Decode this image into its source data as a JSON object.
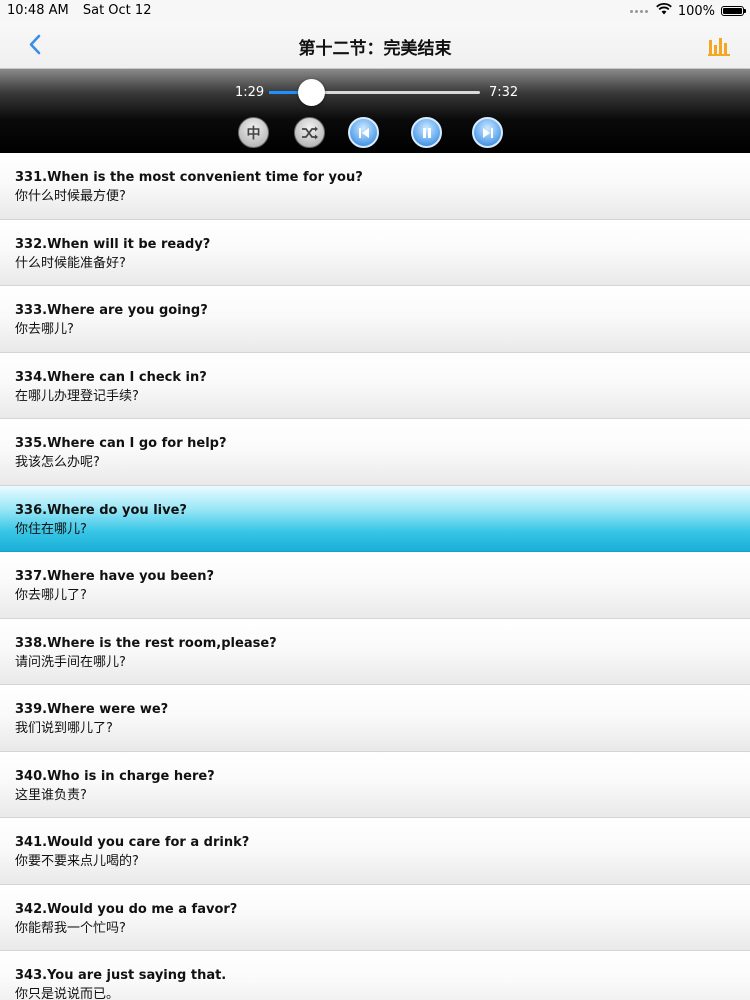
{
  "status_bar": {
    "time": "10:48 AM",
    "date": "Sat Oct 12",
    "battery": "100%",
    "icons": [
      "signal-dots-icon",
      "wifi-icon",
      "battery-icon"
    ]
  },
  "nav": {
    "title": "第十二节：完美结束",
    "back_icon": "chevron-left-icon",
    "chart_icon": "bar-chart-icon",
    "accent_color": "#3a8ee6",
    "chart_color": "#f5a623"
  },
  "player": {
    "current_time": "1:29",
    "total_time": "7:32",
    "progress": 0.198,
    "lang_label": "中",
    "buttons": [
      "lang-button",
      "shuffle-button",
      "previous-button",
      "pause-button",
      "next-button"
    ]
  },
  "list": {
    "active_index": 5,
    "items": [
      {
        "en": "331.When is the most convenient time for you?",
        "zh": "你什么时候最方便?"
      },
      {
        "en": "332.When will it be ready?",
        "zh": "什么时候能准备好?"
      },
      {
        "en": "333.Where are you going?",
        "zh": "你去哪儿?"
      },
      {
        "en": "334.Where can I check in?",
        "zh": "在哪儿办理登记手续?"
      },
      {
        "en": "335.Where can I go for help?",
        "zh": "我该怎么办呢?"
      },
      {
        "en": "336.Where do you live?",
        "zh": "你住在哪儿?"
      },
      {
        "en": "337.Where have you been?",
        "zh": "你去哪儿了?"
      },
      {
        "en": "338.Where is the rest room,please?",
        "zh": "请问洗手间在哪儿?"
      },
      {
        "en": "339.Where were we?",
        "zh": "我们说到哪儿了?"
      },
      {
        "en": "340.Who is in charge here?",
        "zh": "这里谁负责?"
      },
      {
        "en": "341.Would you care for a drink?",
        "zh": "你要不要来点儿喝的?"
      },
      {
        "en": "342.Would you do me a favor?",
        "zh": "你能帮我一个忙吗?"
      },
      {
        "en": "343.You are just saying that.",
        "zh": "你只是说说而已。"
      }
    ]
  }
}
